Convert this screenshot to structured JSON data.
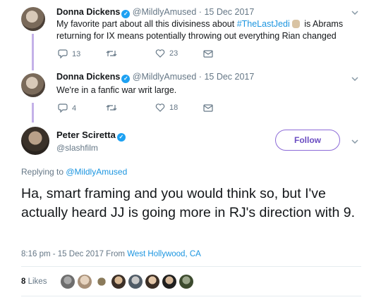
{
  "tweets": [
    {
      "name": "Donna Dickens",
      "handle": "@MildlyAmused",
      "date": "15 Dec 2017",
      "text_before": "My favorite part about all this divisiness about ",
      "hashtag": "#TheLastJedi",
      "text_after": " is Abrams returning for IX means potentially throwing out everything Rian changed",
      "replies": "13",
      "likes": "23"
    },
    {
      "name": "Donna Dickens",
      "handle": "@MildlyAmused",
      "date": "15 Dec 2017",
      "text": "We're in a fanfic war writ large.",
      "replies": "4",
      "likes": "18"
    }
  ],
  "main": {
    "name": "Peter Sciretta",
    "handle": "@slashfilm",
    "follow_label": "Follow",
    "replying_prefix": "Replying to ",
    "replying_handle": "@MildlyAmused",
    "text": "Ha, smart framing and you would think so, but I've actually heard JJ is going more in RJ's direction with 9.",
    "time": "8:16 pm - 15 Dec 2017 From ",
    "location": "West Hollywood, CA",
    "likes_count": "8",
    "likes_label": "Likes"
  },
  "colors": {
    "link": "#1b95e0",
    "verified": "#1da1f2",
    "follow": "#6a4cc1",
    "thread_line": "#c4b1e8"
  },
  "icons": [
    "reply-icon",
    "retweet-icon",
    "heart-icon",
    "message-icon",
    "verified-icon",
    "chevron-down-icon"
  ]
}
